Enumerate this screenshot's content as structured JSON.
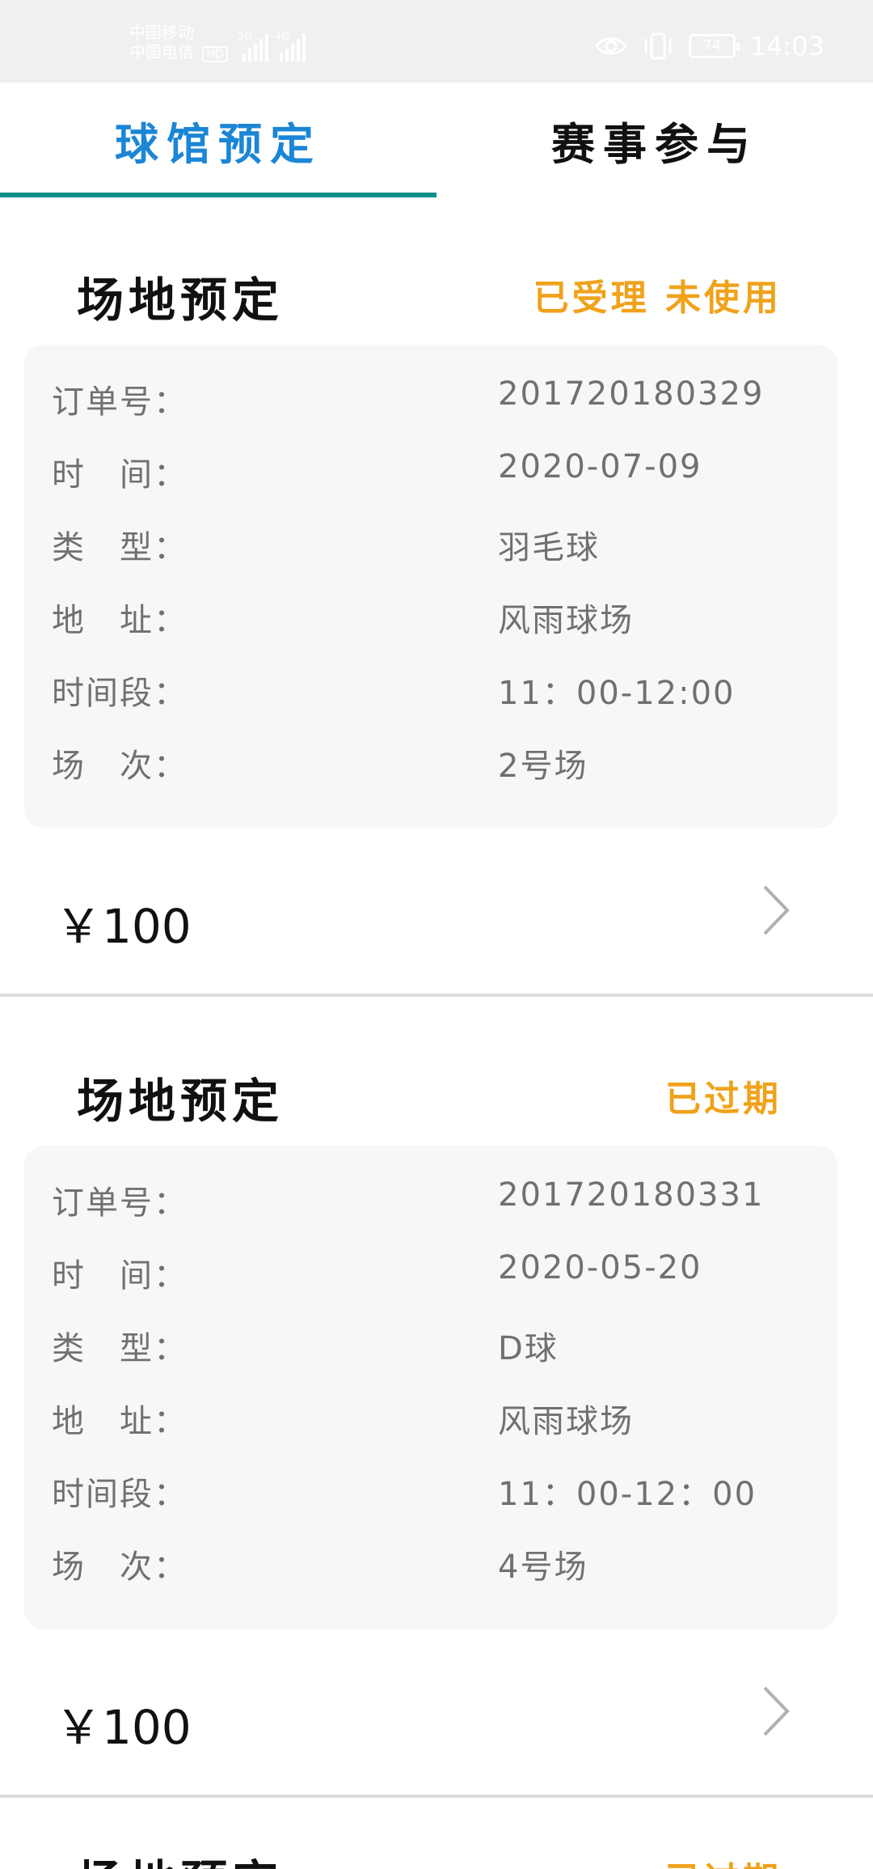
{
  "status_bar": {
    "carrier_1": "中国移动",
    "carrier_2": "中国电信",
    "hd_badge": "HD",
    "signal_1_tag": "2G",
    "signal_2_tag": "4G",
    "battery_level": "74",
    "time": "14:03"
  },
  "tabs": [
    {
      "label": "球馆预定",
      "active": true
    },
    {
      "label": "赛事参与",
      "active": false
    }
  ],
  "colors": {
    "active_tab": "#1b86d6",
    "indicator": "#0f8f88",
    "status": "#f0a21a",
    "card_bg": "#f7f7f7"
  },
  "orders": [
    {
      "title": "场地预定",
      "status": "已受理 未使用",
      "rows": [
        {
          "label": "订单号：",
          "value": "201720180329"
        },
        {
          "label": "时　间：",
          "value": "2020-07-09"
        },
        {
          "label": "类　型：",
          "value": "羽毛球"
        },
        {
          "label": "地　址：",
          "value": "风雨球场"
        },
        {
          "label": "时间段：",
          "value": "11：00-12:00"
        },
        {
          "label": "场　次：",
          "value": "2号场"
        }
      ],
      "price": "￥100"
    },
    {
      "title": "场地预定",
      "status": "已过期",
      "rows": [
        {
          "label": "订单号：",
          "value": "201720180331"
        },
        {
          "label": "时　间：",
          "value": "2020-05-20"
        },
        {
          "label": "类　型：",
          "value": "D球"
        },
        {
          "label": "地　址：",
          "value": "风雨球场"
        },
        {
          "label": "时间段：",
          "value": "11：00-12：00"
        },
        {
          "label": "场　次：",
          "value": "4号场"
        }
      ],
      "price": "￥100"
    },
    {
      "title": "场地预定",
      "status": "已过期"
    }
  ]
}
